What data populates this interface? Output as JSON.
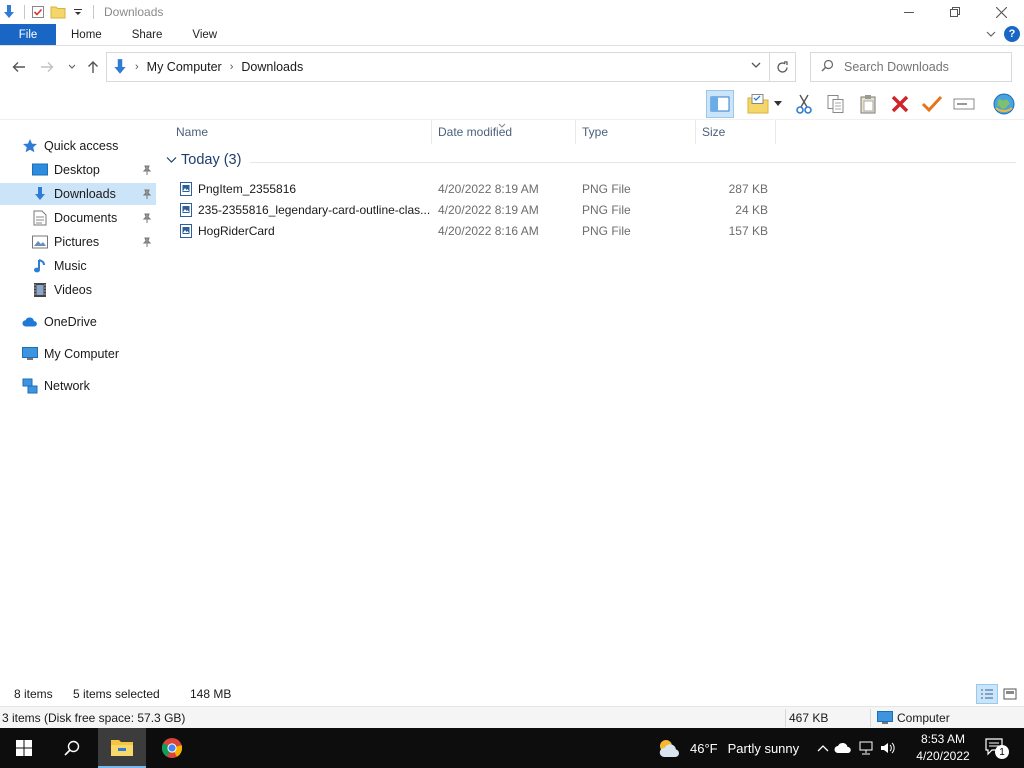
{
  "window": {
    "title": "Downloads"
  },
  "ribbon": {
    "tabs": [
      "File",
      "Home",
      "Share",
      "View"
    ]
  },
  "address": {
    "crumbs": [
      "My Computer",
      "Downloads"
    ]
  },
  "search": {
    "placeholder": "Search Downloads"
  },
  "sidebar": {
    "quick_access": "Quick access",
    "items": [
      {
        "label": "Desktop",
        "icon": "desktop-icon",
        "pinned": true
      },
      {
        "label": "Downloads",
        "icon": "downloads-icon",
        "pinned": true,
        "selected": true
      },
      {
        "label": "Documents",
        "icon": "documents-icon",
        "pinned": true
      },
      {
        "label": "Pictures",
        "icon": "pictures-icon",
        "pinned": true
      },
      {
        "label": "Music",
        "icon": "music-icon",
        "pinned": false
      },
      {
        "label": "Videos",
        "icon": "videos-icon",
        "pinned": false
      }
    ],
    "onedrive": "OneDrive",
    "my_computer": "My Computer",
    "network": "Network"
  },
  "columns": {
    "name": "Name",
    "date": "Date modified",
    "type": "Type",
    "size": "Size"
  },
  "group": {
    "label": "Today (3)"
  },
  "files": [
    {
      "name": "PngItem_2355816",
      "date": "4/20/2022 8:19 AM",
      "type": "PNG File",
      "size": "287 KB"
    },
    {
      "name": "235-2355816_legendary-card-outline-clas...",
      "date": "4/20/2022 8:19 AM",
      "type": "PNG File",
      "size": "24 KB"
    },
    {
      "name": "HogRiderCard",
      "date": "4/20/2022 8:16 AM",
      "type": "PNG File",
      "size": "157 KB"
    }
  ],
  "status": {
    "item_count": "8 items",
    "selection": "5 items selected",
    "selection_size": "148 MB",
    "disk": "3 items (Disk free space: 57.3 GB)",
    "total_size": "467 KB",
    "location": "Computer"
  },
  "taskbar": {
    "weather_temp": "46°F",
    "weather_desc": "Partly sunny",
    "time": "8:53 AM",
    "date": "4/20/2022",
    "notification_count": "1"
  },
  "colors": {
    "accent": "#1a66c4",
    "selection": "#cce4f7",
    "taskbar": "#0d0d0d"
  }
}
